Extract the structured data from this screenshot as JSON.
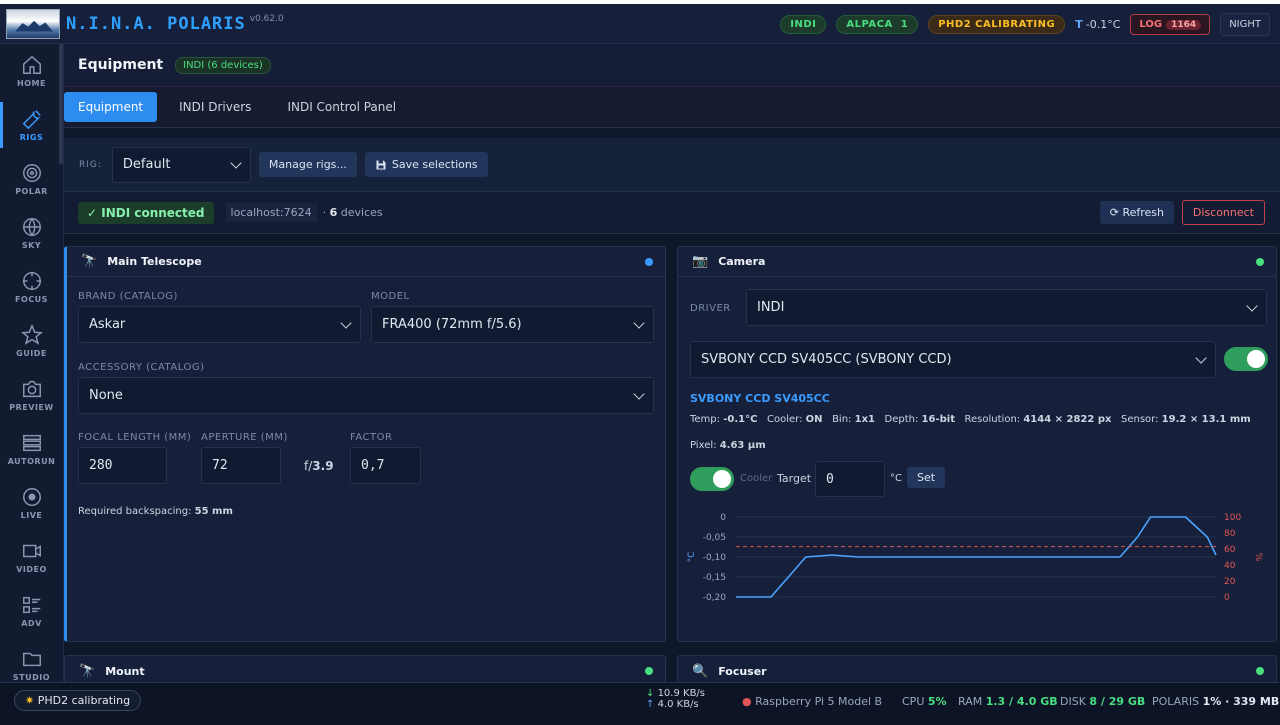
{
  "app": {
    "brand_name": "N.I.N.A. POLARIS",
    "version": "v0.62.0"
  },
  "topbar": {
    "indi_pill": "INDI",
    "alpaca_pill": "ALPACA",
    "alpaca_count": "1",
    "phd2_pill": "PHD2 CALIBRATING",
    "temp_label": "T",
    "temp_value": "-0.1°C",
    "log_label": "LOG",
    "log_count": "1164",
    "night_label": "NIGHT"
  },
  "sidebar": {
    "items": [
      {
        "label": "HOME",
        "icon": "home-icon"
      },
      {
        "label": "RIGS",
        "icon": "wrench-icon"
      },
      {
        "label": "POLAR",
        "icon": "target-icon"
      },
      {
        "label": "SKY",
        "icon": "globe-icon"
      },
      {
        "label": "FOCUS",
        "icon": "crosshair-icon"
      },
      {
        "label": "GUIDE",
        "icon": "star-icon"
      },
      {
        "label": "PREVIEW",
        "icon": "camera-icon"
      },
      {
        "label": "AUTORUN",
        "icon": "stack-icon"
      },
      {
        "label": "LIVE",
        "icon": "record-icon"
      },
      {
        "label": "VIDEO",
        "icon": "video-icon"
      },
      {
        "label": "ADV",
        "icon": "list-icon"
      },
      {
        "label": "STUDIO",
        "icon": "folder-icon"
      }
    ]
  },
  "page": {
    "title": "Equipment",
    "tag": "INDI (6 devices)"
  },
  "tabs": [
    "Equipment",
    "INDI Drivers",
    "INDI Control Panel"
  ],
  "rig": {
    "label": "RIG:",
    "selected": "Default",
    "manage_label": "Manage rigs...",
    "save_label": "Save selections"
  },
  "connection": {
    "status": "INDI connected",
    "host": "localhost:7624",
    "devices_prefix": "·",
    "devices_count": "6",
    "devices_suffix": "devices",
    "refresh_label": "Refresh",
    "disconnect_label": "Disconnect"
  },
  "telescope": {
    "title": "Main Telescope",
    "brand_label": "BRAND (CATALOG)",
    "brand_value": "Askar",
    "model_label": "MODEL",
    "model_value": "FRA400 (72mm f/5.6)",
    "accessory_label": "ACCESSORY (CATALOG)",
    "accessory_value": "None",
    "focal_label": "FOCAL LENGTH (MM)",
    "focal_value": "280",
    "aperture_label": "APERTURE (MM)",
    "aperture_value": "72",
    "fratio_prefix": "f/",
    "fratio_value": "3.9",
    "factor_label": "FACTOR",
    "factor_value": "0,7",
    "backspacing_label": "Required backspacing:",
    "backspacing_value": "55 mm"
  },
  "camera": {
    "title": "Camera",
    "driver_label": "DRIVER",
    "driver_value": "INDI",
    "device_value": "SVBONY CCD SV405CC (SVBONY CCD)",
    "device_name": "SVBONY CCD SV405CC",
    "temp_label": "Temp:",
    "temp_value": "-0.1°C",
    "cooler_label": "Cooler:",
    "cooler_value": "ON",
    "bin_label": "Bin:",
    "bin_value": "1x1",
    "depth_label": "Depth:",
    "depth_value": "16-bit",
    "resolution_label": "Resolution:",
    "resolution_value": "4144 × 2822 px",
    "sensor_label": "Sensor:",
    "sensor_value": "19.2 × 13.1 mm",
    "pixel_label": "Pixel:",
    "pixel_value": "4.63 µm",
    "cooler_toggle_label": "Cooler",
    "target_label": "Target",
    "target_value": "0",
    "target_unit": "°C",
    "set_label": "Set"
  },
  "mount": {
    "title": "Mount"
  },
  "focuser": {
    "title": "Focuser"
  },
  "statusbar": {
    "phd2": "PHD2 calibrating",
    "down_rate": "10.9 KB/s",
    "up_rate": "4.0 KB/s",
    "device": "Raspberry Pi 5 Model B",
    "cpu_label": "CPU",
    "cpu_value": "5%",
    "ram_label": "RAM",
    "ram_value": "1.3 / 4.0 GB",
    "disk_label": "DISK",
    "disk_value": "8 / 29 GB",
    "polaris_label": "POLARIS",
    "polaris_value": "1% · 339 MB"
  },
  "colors": {
    "accent": "#2d8cf0",
    "ok": "#4ade80",
    "warn": "#fbbf24",
    "danger": "#f87171",
    "temp_line": "#4aa3ff",
    "power_line": "#e05555"
  },
  "chart_data": {
    "type": "line",
    "y_left_label": "°C",
    "y_right_label": "%",
    "y_left_ticks": [
      "0",
      "-0,05",
      "-0,10",
      "-0,15",
      "-0,20"
    ],
    "y_right_ticks": [
      "100",
      "80",
      "60",
      "40",
      "20",
      "0"
    ],
    "ylim_left": [
      -0.2,
      0
    ],
    "ylim_right": [
      0,
      100
    ],
    "grid": true,
    "series": [
      {
        "axis": "left",
        "points": [
          [
            0,
            -0.2
          ],
          [
            8,
            -0.2
          ],
          [
            12,
            -0.15
          ],
          [
            16,
            -0.1
          ],
          [
            22,
            -0.095
          ],
          [
            28,
            -0.1
          ],
          [
            40,
            -0.1
          ],
          [
            60,
            -0.1
          ],
          [
            80,
            -0.1
          ],
          [
            86,
            -0.1
          ],
          [
            88,
            -0.1
          ],
          [
            92,
            -0.05
          ],
          [
            95,
            0
          ],
          [
            100,
            0
          ],
          [
            103,
            0
          ],
          [
            108,
            -0.05
          ],
          [
            110,
            -0.095
          ]
        ]
      },
      {
        "axis": "right",
        "style": "dashed",
        "points": [
          [
            0,
            63
          ],
          [
            110,
            63
          ]
        ]
      }
    ],
    "xlim": [
      0,
      110
    ]
  }
}
